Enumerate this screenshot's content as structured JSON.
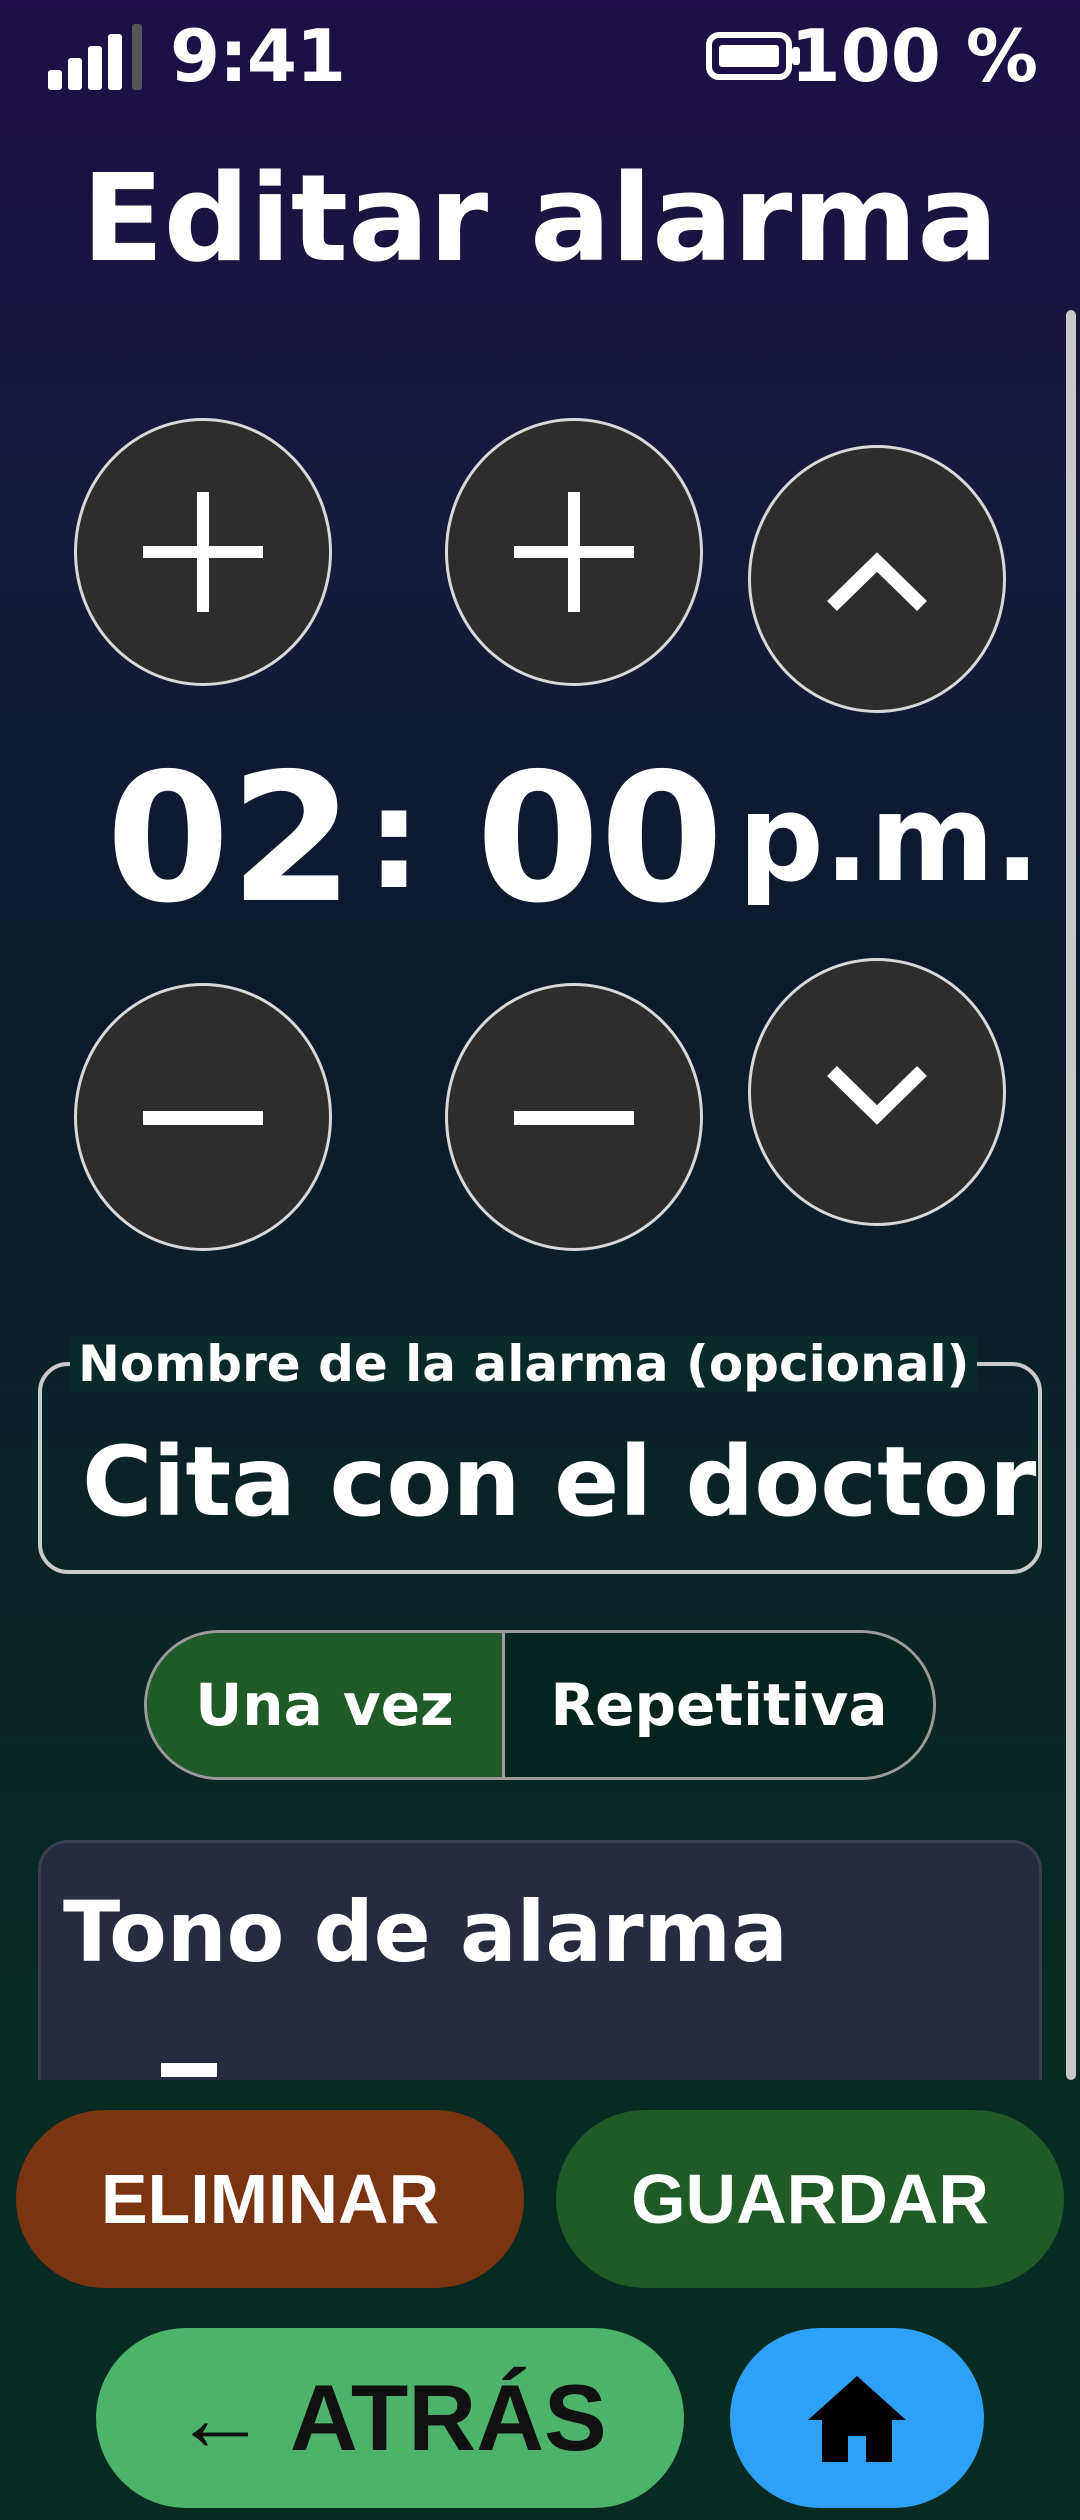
{
  "status_bar": {
    "time": "9:41",
    "battery_percent": "100 %",
    "signal_icon": "signal-bars-icon",
    "battery_icon": "battery-icon"
  },
  "header": {
    "title": "Editar alarma"
  },
  "time_picker": {
    "hour": "02",
    "separator": ":",
    "minute": "00",
    "period": "p.m.",
    "icons": {
      "hour_increment": "plus-icon",
      "minute_increment": "plus-icon",
      "period_up": "chevron-up-icon",
      "hour_decrement": "minus-icon",
      "minute_decrement": "minus-icon",
      "period_down": "chevron-down-icon"
    }
  },
  "name_field": {
    "label": "Nombre de la alarma (opcional)",
    "value": "Cita con el doctor"
  },
  "repeat_toggle": {
    "options": [
      "Una vez",
      "Repetitiva"
    ],
    "selected": "Una vez"
  },
  "tone_section": {
    "title": "Tono de alarma"
  },
  "actions": {
    "delete_label": "ELIMINAR",
    "save_label": "GUARDAR",
    "back_label": "← ATRÁS",
    "home_icon": "home-icon"
  },
  "colors": {
    "delete": "#7a3410",
    "save": "#1f5a27",
    "back": "#4db36a",
    "home": "#2ea0f5",
    "stepper": "#2d2d2d"
  }
}
